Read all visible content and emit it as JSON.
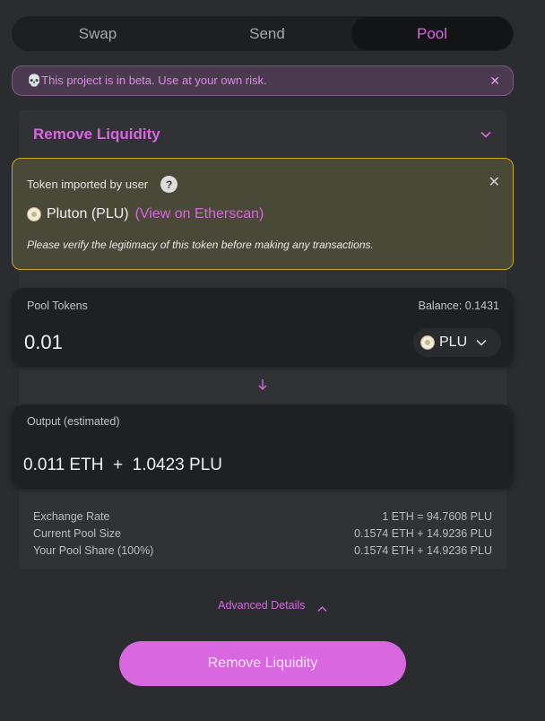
{
  "tabs": [
    {
      "label": "Swap",
      "active": false
    },
    {
      "label": "Send",
      "active": false
    },
    {
      "label": "Pool",
      "active": true
    }
  ],
  "beta_banner": {
    "icon": "skull-icon",
    "text": "💀This project is in beta. Use at your own risk.",
    "close": "✕"
  },
  "card": {
    "title": "Remove Liquidity"
  },
  "import_warning": {
    "header": "Token imported by user",
    "help": "?",
    "token_name": "Pluton (PLU)",
    "link": "(View on Etherscan)",
    "note": "Please verify the legitimacy of this token before making any transactions.",
    "close": "✕"
  },
  "pool_tokens": {
    "label": "Pool Tokens",
    "balance": "Balance: 0.1431",
    "amount": "0.01",
    "token": "PLU"
  },
  "output": {
    "label": "Output (estimated)",
    "value": "0.011 ETH  +  1.0423 PLU"
  },
  "stats": [
    {
      "label": "Exchange Rate",
      "value": "1 ETH = 94.7608 PLU"
    },
    {
      "label": "Current Pool Size",
      "value": "0.1574 ETH + 14.9236 PLU"
    },
    {
      "label": "Your Pool Share (100%)",
      "value": "0.1574 ETH + 14.9236 PLU"
    }
  ],
  "advanced": "Advanced Details",
  "submit": "Remove Liquidity",
  "colors": {
    "accent": "#d867e0",
    "warning_border": "#c9a916",
    "background": "#2b2c2f"
  }
}
